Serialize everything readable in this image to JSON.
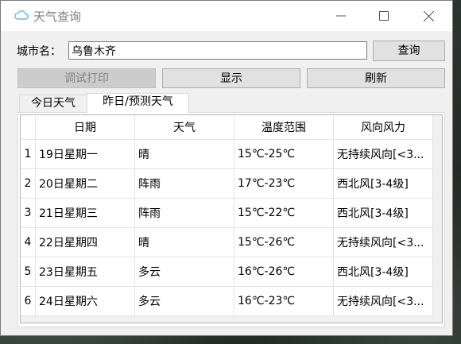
{
  "window": {
    "title": "天气查询"
  },
  "search": {
    "label": "城市名：",
    "value": "乌鲁木齐",
    "button": "查询"
  },
  "toolbar": {
    "debug_label": "调试打印",
    "show_label": "显示",
    "refresh_label": "刷新"
  },
  "tabs": [
    {
      "label": "今日天气",
      "active": false
    },
    {
      "label": "昨日/预测天气",
      "active": true
    }
  ],
  "table": {
    "headers": [
      "日期",
      "天气",
      "温度范围",
      "风向风力"
    ],
    "rows": [
      {
        "num": "1",
        "cells": [
          "19日星期一",
          "晴",
          "15℃-25℃",
          "无持续风向[<3..."
        ]
      },
      {
        "num": "2",
        "cells": [
          "20日星期二",
          "阵雨",
          "17℃-23℃",
          "西北风[3-4级]"
        ]
      },
      {
        "num": "3",
        "cells": [
          "21日星期三",
          "阵雨",
          "15℃-22℃",
          "西北风[3-4级]"
        ]
      },
      {
        "num": "4",
        "cells": [
          "22日星期四",
          "晴",
          "15℃-26℃",
          "无持续风向[<3..."
        ]
      },
      {
        "num": "5",
        "cells": [
          "23日星期五",
          "多云",
          "16℃-26℃",
          "西北风[3-4级]"
        ]
      },
      {
        "num": "6",
        "cells": [
          "24日星期六",
          "多云",
          "16℃-23℃",
          "无持续风向[<3..."
        ]
      }
    ]
  }
}
